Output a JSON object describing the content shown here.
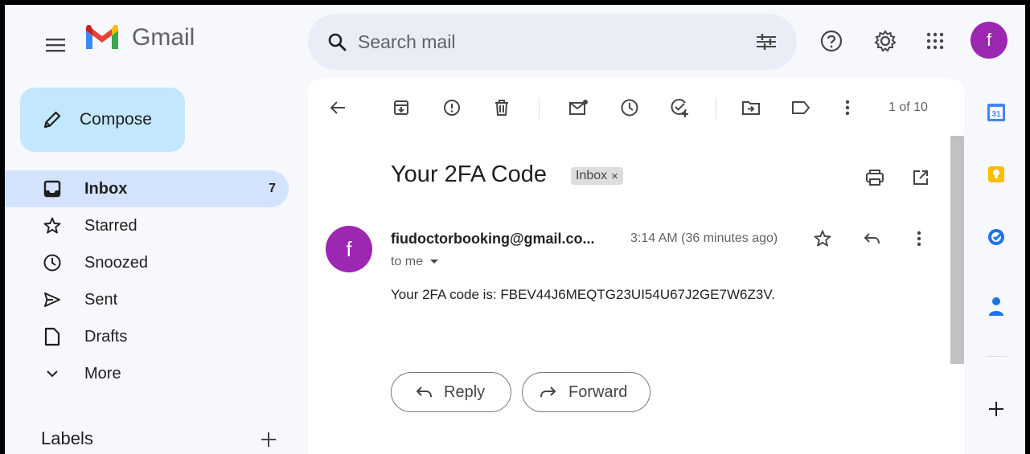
{
  "app": {
    "name": "Gmail"
  },
  "search": {
    "placeholder": "Search mail"
  },
  "header": {
    "avatar_letter": "f"
  },
  "sidebar": {
    "compose_label": "Compose",
    "items": [
      {
        "label": "Inbox",
        "count": "7",
        "icon": "inbox-icon",
        "active": true
      },
      {
        "label": "Starred",
        "count": "",
        "icon": "star-icon"
      },
      {
        "label": "Snoozed",
        "count": "",
        "icon": "clock-icon"
      },
      {
        "label": "Sent",
        "count": "",
        "icon": "send-icon"
      },
      {
        "label": "Drafts",
        "count": "",
        "icon": "draft-icon"
      },
      {
        "label": "More",
        "count": "",
        "icon": "chevron-down-icon"
      }
    ],
    "labels_heading": "Labels"
  },
  "toolbar": {
    "pager": "1 of 10"
  },
  "email": {
    "subject": "Your 2FA Code",
    "label_chip": "Inbox",
    "label_chip_close": "×",
    "sender_avatar_letter": "f",
    "sender": "fiudoctorbooking@gmail.co...",
    "time": "3:14 AM (36 minutes ago)",
    "to": "to me",
    "body": "Your 2FA code is: FBEV44J6MEQTG23UI54U67J2GE7W6Z3V."
  },
  "actions": {
    "reply": "Reply",
    "forward": "Forward"
  },
  "rail": {
    "calendar_day": "31"
  },
  "colors": {
    "accent_purple": "#9c27b0",
    "compose_bg": "#c2e7ff",
    "active_nav": "#d3e3fd",
    "search_bg": "#e9eef6"
  }
}
